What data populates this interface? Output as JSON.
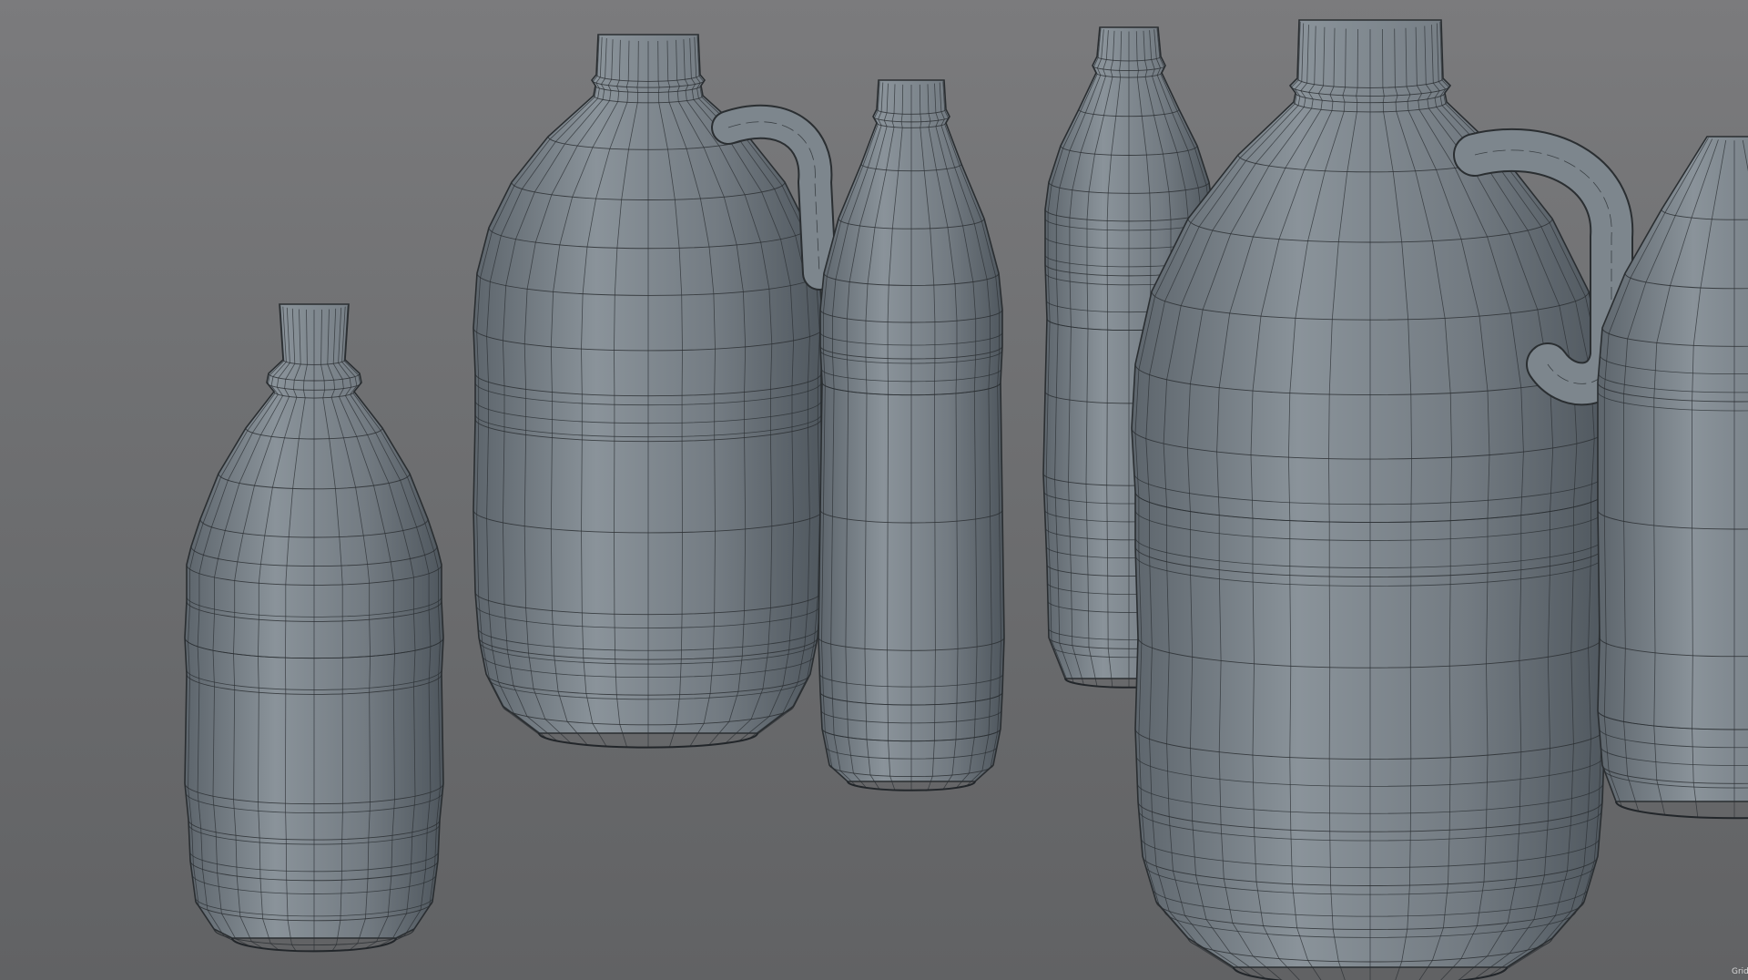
{
  "viewport": {
    "background_top": "#7b7b7d",
    "background_bottom": "#616264",
    "mesh_color": "#7b838a",
    "mesh_shadow_color": "#4d545a",
    "wire_color": "#2b2f33"
  },
  "hud": {
    "grid_label": "Grid S"
  },
  "objects": [
    {
      "name": "small-bottle"
    },
    {
      "name": "jug-back"
    },
    {
      "name": "tall-bottle-middle"
    },
    {
      "name": "tall-bottle-back"
    },
    {
      "name": "jug-front"
    },
    {
      "name": "bottle-partial-right"
    }
  ]
}
